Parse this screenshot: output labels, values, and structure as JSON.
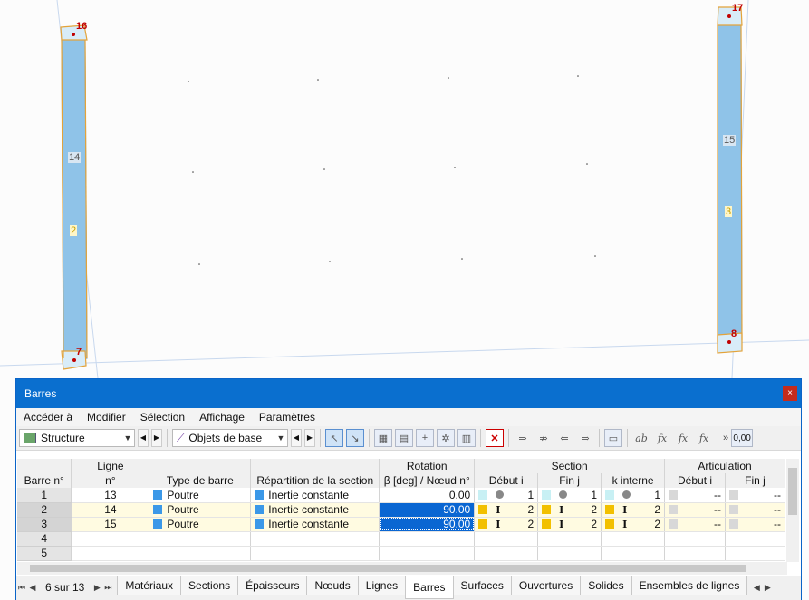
{
  "model": {
    "node_labels": [
      "16",
      "17",
      "7",
      "8"
    ],
    "line_labels": [
      "14",
      "15"
    ],
    "member_labels": [
      "2",
      "3"
    ]
  },
  "window": {
    "title": "Barres",
    "close_glyph": "×",
    "menu": [
      "Accéder à",
      "Modifier",
      "Sélection",
      "Affichage",
      "Paramètres"
    ],
    "toolbar": {
      "combo1": "Structure",
      "combo2": "Objets de base",
      "decimal_label": "0,00"
    }
  },
  "table": {
    "group_headers": {
      "rotation": "Rotation",
      "section": "Section",
      "articulation": "Articulation"
    },
    "headers": {
      "barre": "Barre n°",
      "ligne_top": "Ligne",
      "ligne_bottom": "n°",
      "type": "Type de barre",
      "repartition": "Répartition de la section",
      "rotation": "β [deg] / Nœud n°",
      "sec_debut": "Début i",
      "sec_fin": "Fin j",
      "sec_kint": "k interne",
      "art_debut": "Début i",
      "art_fin": "Fin j"
    },
    "rows": [
      {
        "n": "1",
        "ligne": "13",
        "type": "Poutre",
        "rep": "Inertie constante",
        "rot": "0.00",
        "deb": "1",
        "fin": "1",
        "kint": "1",
        "art_deb": "--",
        "art_fin": "--"
      },
      {
        "n": "2",
        "ligne": "14",
        "type": "Poutre",
        "rep": "Inertie constante",
        "rot": "90.00",
        "deb": "2",
        "fin": "2",
        "kint": "2",
        "art_deb": "--",
        "art_fin": "--"
      },
      {
        "n": "3",
        "ligne": "15",
        "type": "Poutre",
        "rep": "Inertie constante",
        "rot": "90.00",
        "deb": "2",
        "fin": "2",
        "kint": "2",
        "art_deb": "--",
        "art_fin": "--"
      },
      {
        "n": "4"
      },
      {
        "n": "5"
      }
    ]
  },
  "tabs": {
    "page_label": "6 sur 13",
    "items": [
      "Matériaux",
      "Sections",
      "Épaisseurs",
      "Nœuds",
      "Lignes",
      "Barres",
      "Surfaces",
      "Ouvertures",
      "Solides",
      "Ensembles de lignes"
    ],
    "active": "Barres"
  },
  "colors": {
    "accent": "#0a6fcf",
    "member_fill": "#8fc3e8",
    "member_outline": "#e3a33a",
    "node": "#c00000",
    "selection": "#0a66d2",
    "arrow": "#1a1ad0"
  }
}
